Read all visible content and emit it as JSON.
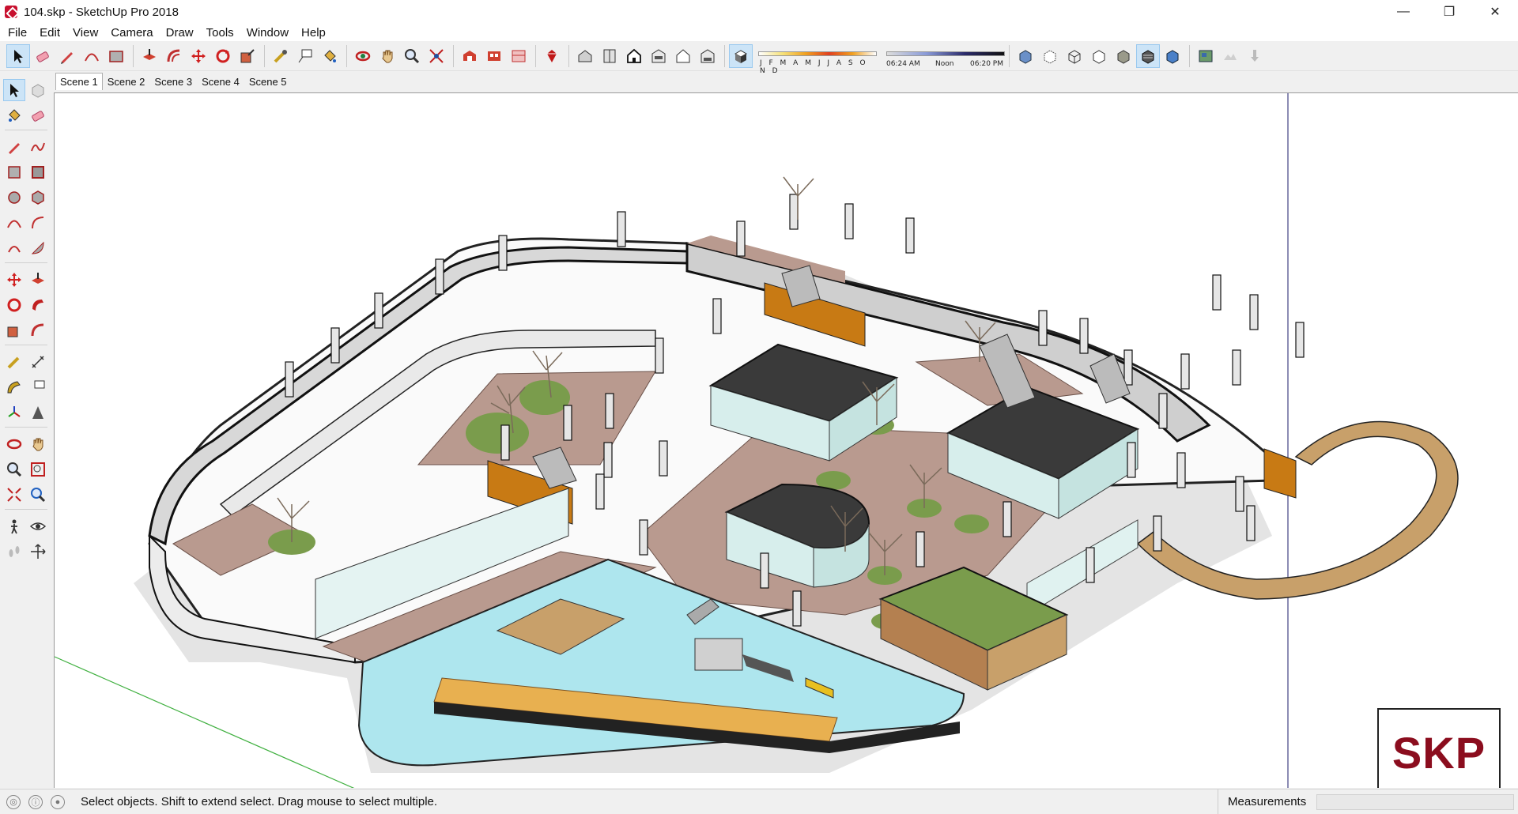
{
  "window": {
    "title": "104.skp - SketchUp Pro 2018",
    "controls": {
      "minimize": "—",
      "restore": "❐",
      "close": "✕"
    }
  },
  "menu": [
    "File",
    "Edit",
    "View",
    "Camera",
    "Draw",
    "Tools",
    "Window",
    "Help"
  ],
  "shadow_widget": {
    "months": "J F M A M J J A S O N D",
    "time_start": "06:24 AM",
    "time_mid": "Noon",
    "time_end": "06:20 PM"
  },
  "scenes": [
    "Scene 1",
    "Scene 2",
    "Scene 3",
    "Scene 4",
    "Scene 5"
  ],
  "active_scene": "Scene 1",
  "status": {
    "message": "Select objects. Shift to extend select. Drag mouse to select multiple.",
    "measurements_label": "Measurements",
    "measurements_value": ""
  },
  "badge": {
    "text": "SKP"
  },
  "colors": {
    "accent": "#cce4f7",
    "pool": "#aee6ee",
    "paving": "#b99a8f",
    "roof": "#3a3a3a",
    "grass": "#7a9c4c",
    "wood": "#c8a06a",
    "badge_text": "#8b0d1e"
  }
}
